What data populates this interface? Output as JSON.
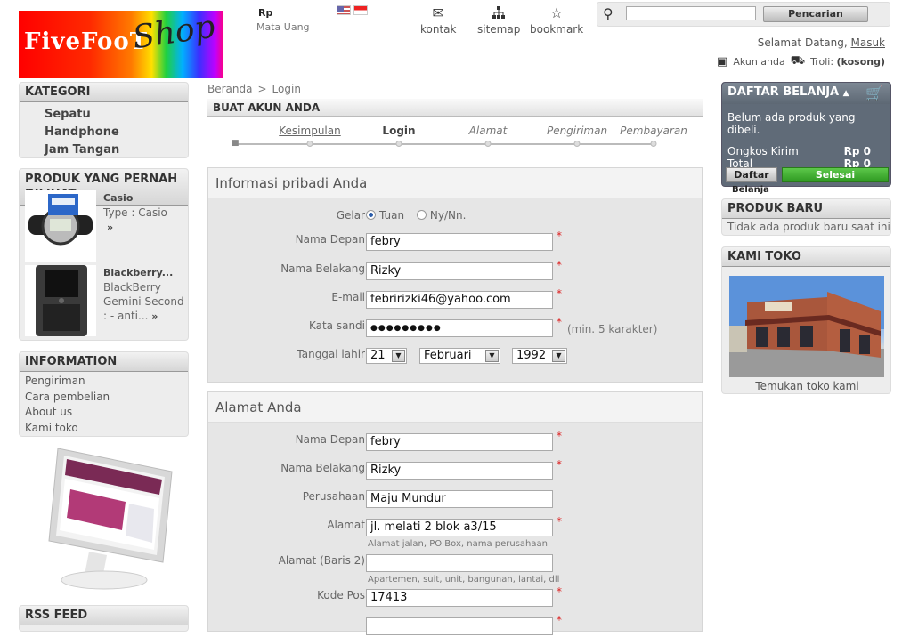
{
  "header": {
    "logo_text": "FiveFooT Shop",
    "currency_symbol": "Rp",
    "currency_label": "Mata Uang",
    "nav": [
      {
        "label": "kontak",
        "icon": "envelope-icon"
      },
      {
        "label": "sitemap",
        "icon": "sitemap-icon"
      },
      {
        "label": "bookmark",
        "icon": "star-icon"
      }
    ],
    "search_value": "",
    "search_button": "Pencarian",
    "welcome": "Selamat Datang,",
    "login_link": "Masuk",
    "account_label": "Akun anda",
    "cart_label": "Troli:",
    "cart_status": "(kosong)"
  },
  "kategori": {
    "title": "KATEGORI",
    "items": [
      "Sepatu",
      "Handphone",
      "Jam Tangan"
    ]
  },
  "produk": {
    "title": "PRODUK YANG PERNAH DILIHAT",
    "items": [
      {
        "name": "Casio",
        "desc": "Type : Casio",
        "more": "»"
      },
      {
        "name": "Blackberry...",
        "desc": "BlackBerry Gemini Second : - anti...",
        "more": "»"
      }
    ]
  },
  "information": {
    "title": "INFORMATION",
    "items": [
      "Pengiriman",
      "Cara pembelian",
      "About us",
      "Kami toko"
    ]
  },
  "rss": {
    "title": "RSS FEED"
  },
  "breadcrumb": {
    "home": "Beranda",
    "sep": ">",
    "current": "Login"
  },
  "page_title": "BUAT AKUN ANDA",
  "steps": [
    "Kesimpulan",
    "Login",
    "Alamat",
    "Pengiriman",
    "Pembayaran"
  ],
  "personal": {
    "title": "Informasi pribadi Anda",
    "gelar_label": "Gelar",
    "gelar_options": [
      "Tuan",
      "Ny/Nn."
    ],
    "first_name_label": "Nama Depan",
    "first_name": "febry",
    "last_name_label": "Nama Belakang",
    "last_name": "Rizky",
    "email_label": "E-mail",
    "email": "febririzki46@yahoo.com",
    "password_label": "Kata sandi",
    "password": "●●●●●●●●●",
    "password_hint": "(min. 5 karakter)",
    "dob_label": "Tanggal lahir",
    "dob_day": "21",
    "dob_month": "Februari",
    "dob_year": "1992"
  },
  "address": {
    "title": "Alamat Anda",
    "first_name_label": "Nama Depan",
    "first_name": "febry",
    "last_name_label": "Nama Belakang",
    "last_name": "Rizky",
    "company_label": "Perusahaan",
    "company": "Maju Mundur",
    "address_label": "Alamat",
    "address": "jl. melati 2 blok a3/15",
    "address_hint": "Alamat jalan, PO Box, nama perusahaan",
    "address2_label": "Alamat (Baris 2)",
    "address2": "",
    "address2_hint": "Apartemen, suit, unit, bangunan, lantai, dll",
    "postcode_label": "Kode Pos",
    "postcode": "17413",
    "required_mark": "*"
  },
  "cart": {
    "title": "DAFTAR BELANJA",
    "empty": "Belum ada produk yang dibeli.",
    "shipping_label": "Ongkos Kirim",
    "shipping_value": "Rp 0",
    "total_label": "Total",
    "total_value": "Rp 0",
    "list_button": "Daftar",
    "list_button_overflow": "Belanja",
    "checkout_button": "Selesai"
  },
  "produk_baru": {
    "title": "PRODUK BARU",
    "text": "Tidak ada produk baru saat ini"
  },
  "kami_toko": {
    "title": "KAMI TOKO",
    "caption": "Temukan toko kami"
  }
}
